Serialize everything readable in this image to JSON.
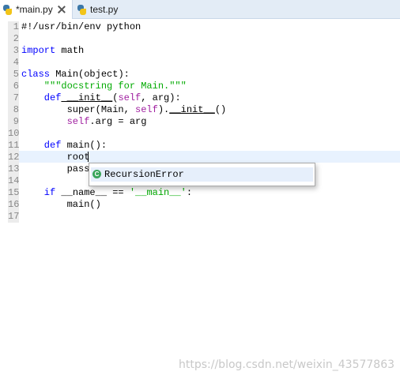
{
  "tabs": [
    {
      "label": "*main.py",
      "active": true
    },
    {
      "label": "test.py",
      "active": false
    }
  ],
  "line_numbers": [
    "1",
    "2",
    "3",
    "4",
    "5",
    "6",
    "7",
    "8",
    "9",
    "10",
    "11",
    "12",
    "13",
    "14",
    "15",
    "16",
    "17"
  ],
  "code": {
    "l1": "#!/usr/bin/env python",
    "l3_kw": "import",
    "l3_rest": " math",
    "l5_kw": "class",
    "l5_name": " Main",
    "l5_rest": "(object):",
    "l6": "    \"\"\"docstring for Main.\"\"\"",
    "l7_kw": "    def",
    "l7_fn": " __init__",
    "l7_p": "(",
    "l7_self": "self",
    "l7_rest": ", arg):",
    "l8_a": "        super(Main, ",
    "l8_self": "self",
    "l8_b": ").",
    "l8_fn": "__init__",
    "l8_c": "()",
    "l9_self": "        self",
    "l9_rest": ".arg = arg",
    "l11_kw": "    def",
    "l11_rest": " main():",
    "l12": "        root",
    "l13": "        pass",
    "l15_kw": "    if",
    "l15_a": " __name__ == ",
    "l15_str": "'__main__'",
    "l15_b": ":",
    "l16": "        main()"
  },
  "autocomplete": {
    "icon": "class-icon",
    "item": "RecursionError"
  },
  "watermark": "https://blog.csdn.net/weixin_43577863"
}
